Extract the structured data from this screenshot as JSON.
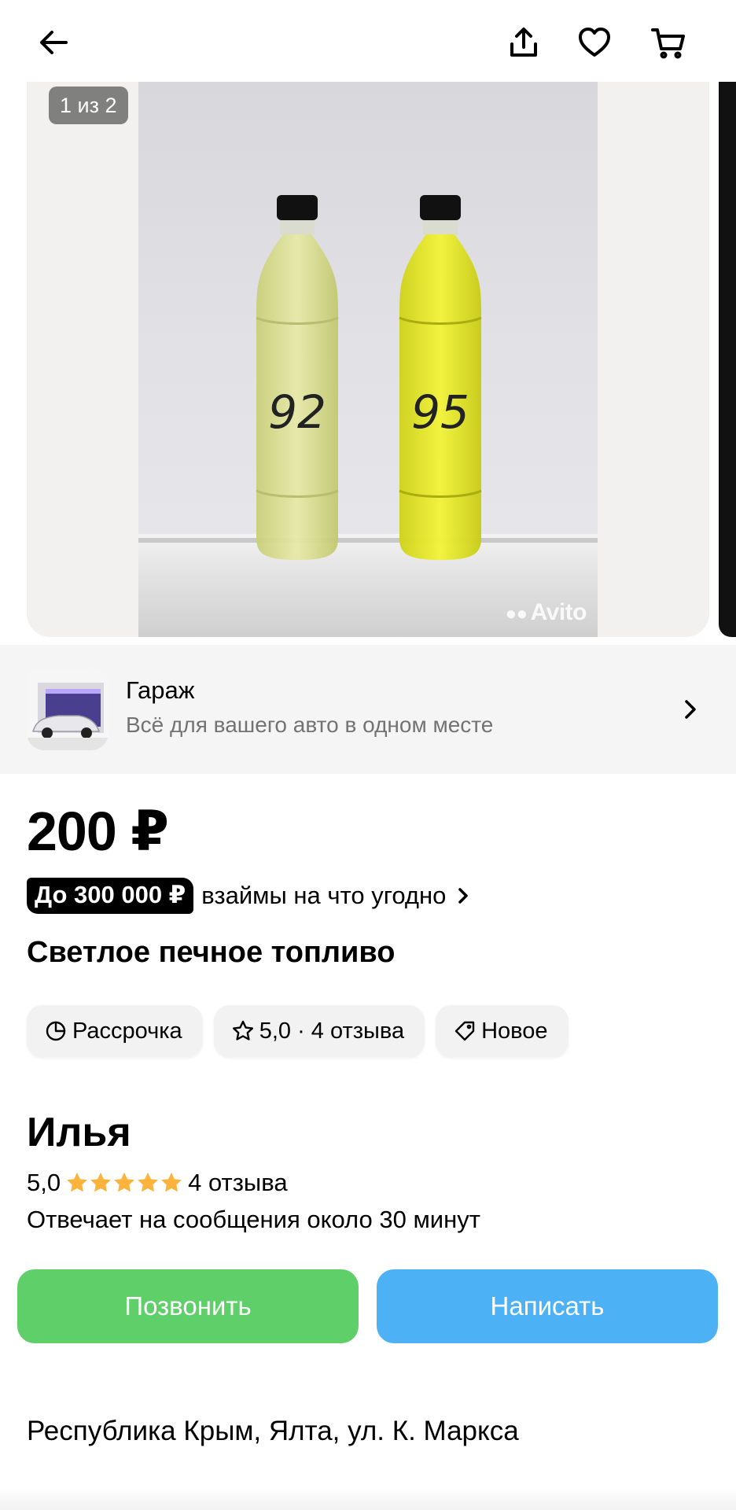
{
  "gallery": {
    "counter": "1 из 2",
    "watermark": "Avito",
    "bottle_labels": [
      "92",
      "95"
    ]
  },
  "shop": {
    "name": "Гараж",
    "description": "Всё для вашего авто в одном месте"
  },
  "listing": {
    "price": "200 ₽",
    "loan_badge": "До 300 000 ₽",
    "loan_text": "взаймы на что угодно",
    "title": "Светлое печное топливо",
    "chips": [
      {
        "icon": "pie-chart-icon",
        "label": "Рассрочка"
      },
      {
        "icon": "star-outline-icon",
        "label": "5,0 · 4 отзыва"
      },
      {
        "icon": "tag-icon",
        "label": "Новое"
      }
    ]
  },
  "seller": {
    "name": "Илья",
    "rating": "5,0",
    "stars": 5,
    "reviews": "4 отзыва",
    "response_time": "Отвечает на сообщения около 30 минут"
  },
  "actions": {
    "call": "Позвонить",
    "message": "Написать"
  },
  "location": {
    "address": "Республика Крым, Ялта, ул. К. Маркса"
  },
  "colors": {
    "call_button": "#5fcf6a",
    "message_button": "#4db2f5",
    "star": "#fcb33c"
  }
}
